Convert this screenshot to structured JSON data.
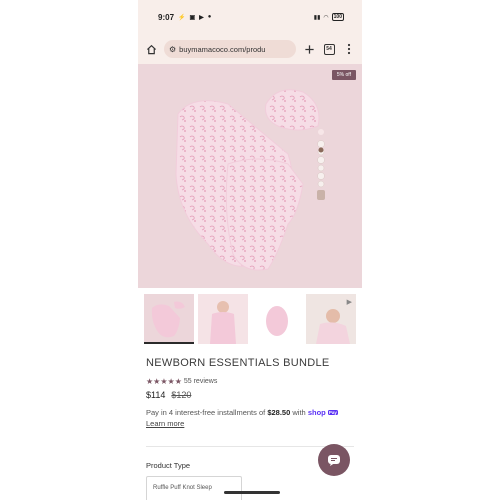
{
  "status_bar": {
    "time": "9:07",
    "battery": "100"
  },
  "browser": {
    "url": "buymamacoco.com/produ",
    "tabs_count": "54"
  },
  "product": {
    "discount_badge": "5% off",
    "title": "NEWBORN ESSENTIALS BUNDLE",
    "review_count": "55 reviews",
    "rating_stars": "★★★★★",
    "rating": 5,
    "price": "$114",
    "original_price": "$120",
    "installments_prefix": "Pay in 4 interest-free installments of",
    "installment_amount": "$28.50",
    "installments_with": "with",
    "shop_pay_brand": "shop",
    "shop_pay_badge": "Pay",
    "learn_more": "Learn more",
    "product_type_label": "Product Type",
    "product_type_value": "Ruffle Puff Knot Sleep"
  },
  "colors": {
    "accent": "#7a5563",
    "hero_bg": "#ecd6da",
    "browser_bg": "#f8eeea",
    "shop_pay": "#5a31f4"
  },
  "icons": [
    "home-icon",
    "site-settings-icon",
    "new-tab-icon",
    "tabs-icon",
    "menu-icon",
    "play-icon",
    "chat-icon"
  ]
}
